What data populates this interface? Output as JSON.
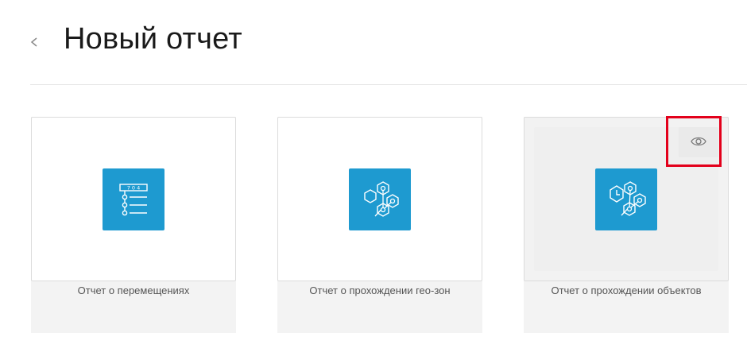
{
  "header": {
    "back_icon": "chevron-left-icon",
    "title": "Новый отчет"
  },
  "cards": [
    {
      "label": "Отчет о перемещениях",
      "icon": "movement-report-icon",
      "counter_text": "7 0 4",
      "hovered": false
    },
    {
      "label": "Отчет о прохождении гео-зон",
      "icon": "geozone-report-icon",
      "hovered": false
    },
    {
      "label": "Отчет о прохождении объектов",
      "icon": "objects-report-icon",
      "hovered": true,
      "preview_icon": "eye-icon"
    }
  ],
  "colors": {
    "icon_bg": "#1e9ad0",
    "highlight": "#e3001b",
    "card_bg": "#f3f3f3"
  }
}
